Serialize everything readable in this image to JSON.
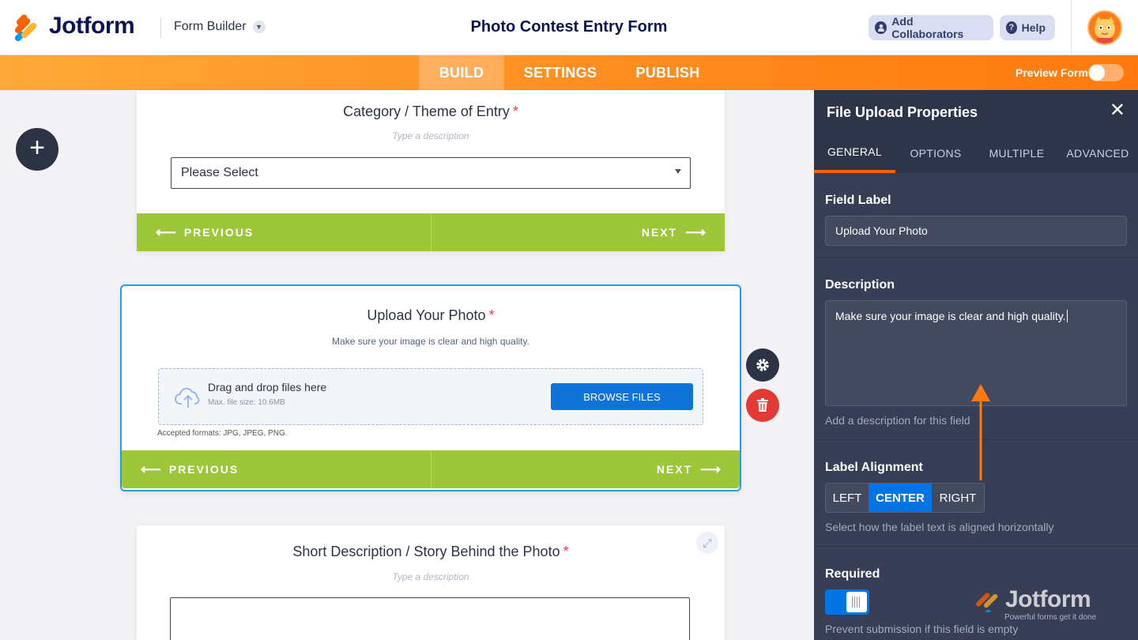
{
  "header": {
    "brand": "Jotform",
    "builder_menu": "Form Builder",
    "form_title": "Photo Contest Entry Form",
    "add_collaborators": "Add Collaborators",
    "help": "Help"
  },
  "nav": {
    "tabs": [
      "BUILD",
      "SETTINGS",
      "PUBLISH"
    ],
    "active_tab": "BUILD",
    "preview_label": "Preview Form",
    "preview_on": false
  },
  "canvas": {
    "category_card": {
      "label": "Category / Theme of Entry",
      "required_mark": "*",
      "description_placeholder": "Type a description",
      "select_value": "Please Select",
      "prev": "PREVIOUS",
      "next": "NEXT"
    },
    "upload_card": {
      "label": "Upload Your Photo",
      "required_mark": "*",
      "description": "Make sure your image is clear and high quality.",
      "drag_text": "Drag and drop files here",
      "max_size": "Max. file size: 10.6MB",
      "browse": "BROWSE FILES",
      "accepted": "Accepted formats: JPG, JPEG, PNG.",
      "prev": "PREVIOUS",
      "next": "NEXT"
    },
    "story_card": {
      "label": "Short Description / Story Behind the Photo",
      "required_mark": "*",
      "description_placeholder": "Type a description"
    }
  },
  "panel": {
    "title": "File Upload Properties",
    "tabs": [
      "GENERAL",
      "OPTIONS",
      "MULTIPLE",
      "ADVANCED"
    ],
    "active_tab": "GENERAL",
    "field_label_title": "Field Label",
    "field_label_value": "Upload Your Photo",
    "description_title": "Description",
    "description_value": "Make sure your image is clear and high quality.",
    "description_hint": "Add a description for this field",
    "alignment_title": "Label Alignment",
    "alignment_options": [
      "LEFT",
      "CENTER",
      "RIGHT"
    ],
    "alignment_selected": "CENTER",
    "alignment_hint": "Select how the label text is aligned horizontally",
    "required_title": "Required",
    "required_on": true,
    "required_hint": "Prevent submission if this field is empty"
  },
  "watermark": {
    "brand": "Jotform",
    "tagline": "Powerful forms get it done"
  },
  "colors": {
    "brand_navy": "#0a1551",
    "nav_orange": "#ff8a1e",
    "pager_green": "#9dc63b",
    "accent_blue": "#0075e3",
    "panel_bg": "#373e55",
    "required_red": "#f23a3c"
  }
}
